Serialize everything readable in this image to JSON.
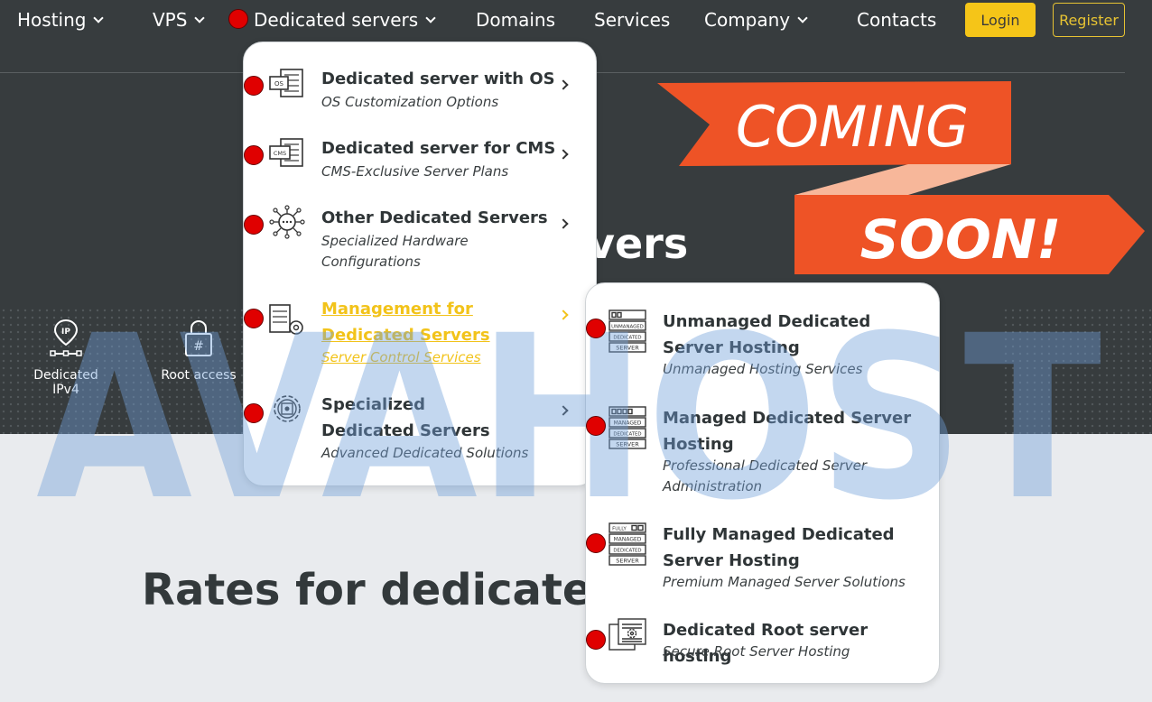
{
  "nav": {
    "items": [
      {
        "label": "Hosting",
        "has_dropdown": true
      },
      {
        "label": "VPS",
        "has_dropdown": true
      },
      {
        "label": "Dedicated servers",
        "has_dropdown": true
      },
      {
        "label": "Domains",
        "has_dropdown": false
      },
      {
        "label": "Services",
        "has_dropdown": false
      },
      {
        "label": "Company",
        "has_dropdown": true
      },
      {
        "label": "Contacts",
        "has_dropdown": false
      }
    ],
    "login_label": "Login",
    "register_label": "Register"
  },
  "hero": {
    "title_fragment": "vers",
    "features": [
      {
        "label": "Dedicated IPv4",
        "icon": "ip-pin-icon"
      },
      {
        "label": "Root access",
        "icon": "lock-hash-icon"
      }
    ],
    "banner": {
      "line1": "COMING",
      "line2": "SOON!"
    }
  },
  "rates": {
    "title": "Rates for dedicated se"
  },
  "watermark": {
    "text": "AVAHOST"
  },
  "menu_primary": [
    {
      "title": "Dedicated server with OS",
      "subtitle": "OS Customization Options",
      "icon": "server-os-icon",
      "active": false
    },
    {
      "title": "Dedicated server for CMS",
      "subtitle": "CMS-Exclusive Server Plans",
      "icon": "server-cms-icon",
      "active": false
    },
    {
      "title": "Other Dedicated Servers",
      "subtitle": "Specialized Hardware Configurations",
      "icon": "network-nodes-icon",
      "active": false
    },
    {
      "title": "Management for Dedicated Servers",
      "subtitle": "Server Control Services",
      "icon": "server-gear-icon",
      "active": true
    },
    {
      "title": "Specialized Dedicated Servers",
      "subtitle": "Advanced Dedicated Solutions",
      "icon": "gear-chip-icon",
      "active": false
    }
  ],
  "menu_secondary": [
    {
      "title": "Unmanaged Dedicated Server Hosting",
      "subtitle": "Unmanaged Hosting Services",
      "icon": "server-stack-unmanaged-icon",
      "stack_labels": [
        "UNMANAGED",
        "DEDICATED",
        "SERVER"
      ]
    },
    {
      "title": "Managed Dedicated Server Hosting",
      "subtitle": "Professional Dedicated Server Administration",
      "icon": "server-stack-managed-icon",
      "stack_labels": [
        "MANAGED",
        "DEDICATED",
        "SERVER"
      ]
    },
    {
      "title": "Fully Managed Dedicated Server Hosting",
      "subtitle": "Premium Managed Server Solutions",
      "icon": "server-stack-fully-managed-icon",
      "stack_labels": [
        "FULLY",
        "MANAGED",
        "DEDICATED",
        "SERVER"
      ]
    },
    {
      "title": "Dedicated Root server hosting",
      "subtitle": "Secure Root Server Hosting",
      "icon": "server-root-gear-icon",
      "stack_labels": []
    }
  ],
  "colors": {
    "hero_bg": "#373c3e",
    "accent_yellow": "#f5c518",
    "banner_orange": "#ee5326",
    "banner_light": "#f7b79a",
    "page_bg": "#e9ebee",
    "marker_red": "#e00000"
  }
}
